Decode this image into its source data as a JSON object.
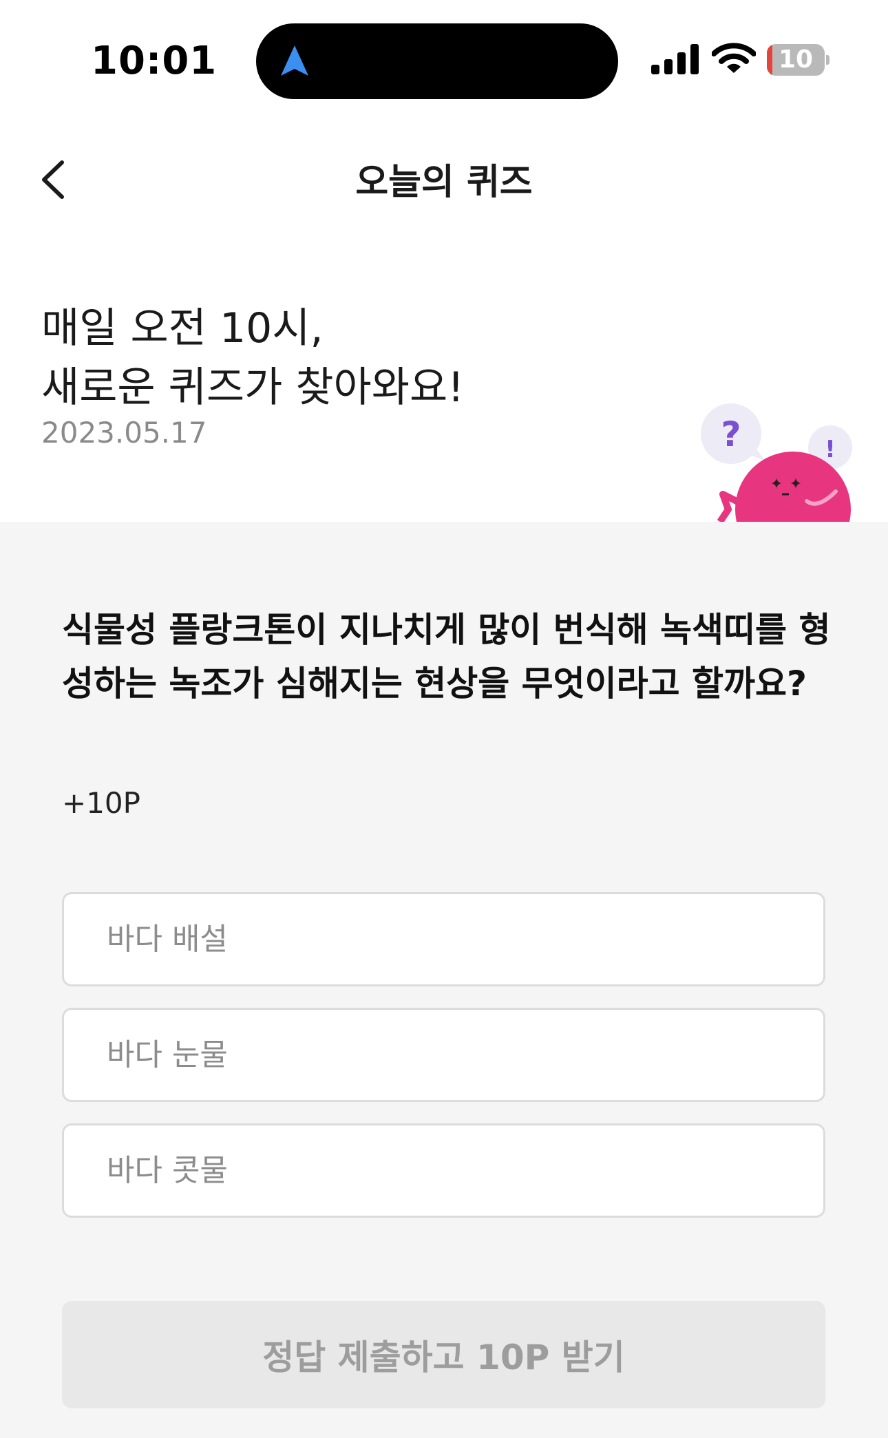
{
  "status_bar": {
    "time": "10:01",
    "battery_level": "10",
    "icons": [
      "navigation-arrow-icon",
      "cellular-signal-icon",
      "wifi-icon",
      "battery-icon"
    ]
  },
  "header": {
    "title": "오늘의 퀴즈",
    "back_icon": "chevron-left-icon"
  },
  "intro": {
    "line1": "매일 오전 10시,",
    "line2": "새로운 퀴즈가 찾아와요!",
    "date": "2023.05.17",
    "mascot_badges": [
      "?",
      "!"
    ]
  },
  "quiz": {
    "question": "식물성 플랑크톤이 지나치게 많이 번식해 녹색띠를 형성하는 녹조가 심해지는 현상을 무엇이라고 할까요?",
    "points": "+10P",
    "options": [
      {
        "label": "바다 배설"
      },
      {
        "label": "바다 눈물"
      },
      {
        "label": "바다 콧물"
      }
    ],
    "submit_label": "정답 제출하고 10P 받기"
  },
  "colors": {
    "background": "#f5f5f5",
    "mascot_pink": "#e8357f",
    "bubble_purple": "#7a4fd0",
    "submit_disabled_bg": "#e8e8e8",
    "submit_disabled_text": "#9d9d9d"
  }
}
